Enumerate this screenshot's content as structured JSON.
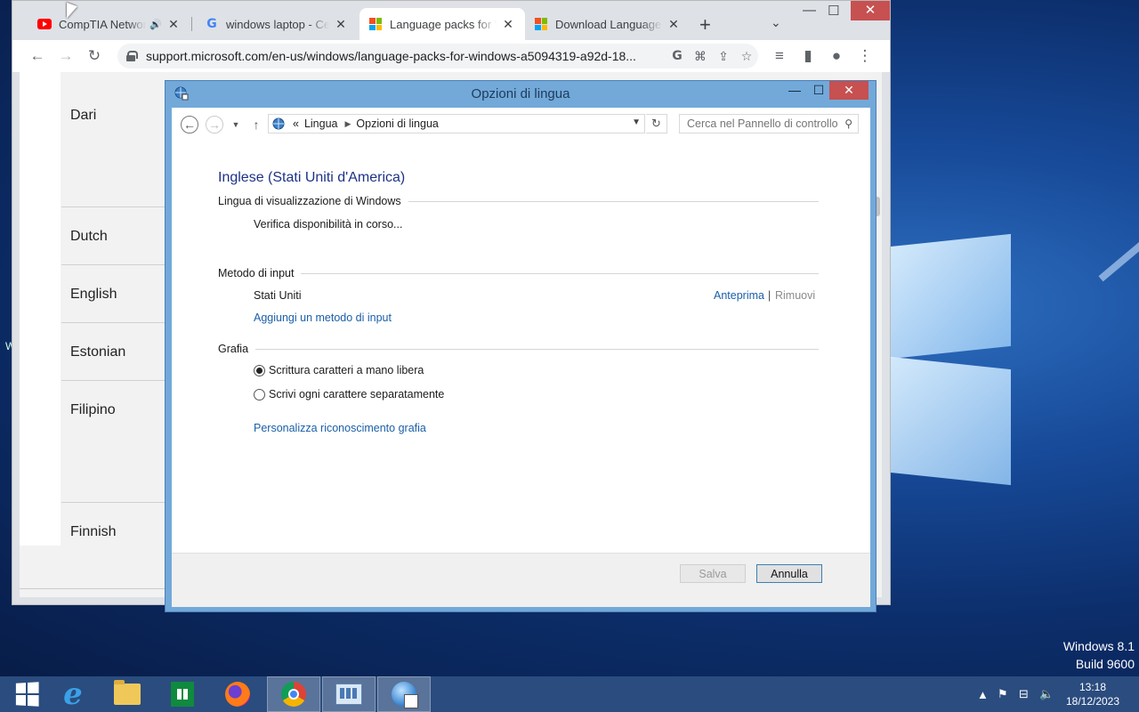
{
  "desktop": {
    "edge_letter": "W",
    "os_name": "Windows 8.1",
    "build": "Build 9600"
  },
  "browser": {
    "tabs": [
      {
        "title": "CompTIA Network",
        "favicon": "youtube-icon",
        "audio": "speaker-icon",
        "active": false
      },
      {
        "title": "windows laptop - Cerca",
        "favicon": "google-icon",
        "active": false
      },
      {
        "title": "Language packs for Windows",
        "favicon": "microsoft-icon",
        "active": true
      },
      {
        "title": "Download Language Interface",
        "favicon": "microsoft-icon",
        "active": false
      }
    ],
    "new_tab_label": "+",
    "url": "support.microsoft.com/en-us/windows/language-packs-for-windows-a5094319-a92d-18..."
  },
  "webpage": {
    "languages": [
      "Dari",
      "Dutch",
      "English",
      "Estonian",
      "Filipino",
      "Finnish"
    ]
  },
  "dialog": {
    "title": "Opzioni di lingua",
    "breadcrumb": {
      "prefix": "«",
      "items": [
        "Lingua",
        "Opzioni di lingua"
      ]
    },
    "search_placeholder": "Cerca nel Pannello di controllo",
    "language_name": "Inglese (Stati Uniti d'America)",
    "display_section": {
      "heading": "Lingua di visualizzazione di Windows",
      "status": "Verifica disponibilità in corso..."
    },
    "input_section": {
      "heading": "Metodo di input",
      "method": "Stati Uniti",
      "preview_link": "Anteprima",
      "separator": "|",
      "remove_link": "Rimuovi",
      "add_link": "Aggiungi un metodo di input"
    },
    "handwriting_section": {
      "heading": "Grafia",
      "options": [
        {
          "label": "Scrittura caratteri a mano libera",
          "checked": true
        },
        {
          "label": "Scrivi ogni carattere separatamente",
          "checked": false
        }
      ],
      "personalize_link": "Personalizza riconoscimento grafia"
    },
    "buttons": {
      "save": "Salva",
      "cancel": "Annulla"
    }
  },
  "taskbar": {
    "time": "13:18",
    "date": "18/12/2023"
  },
  "colors": {
    "accent_link": "#1a5fa8",
    "title_blue": "#1e3287",
    "close_red": "#c75050"
  }
}
